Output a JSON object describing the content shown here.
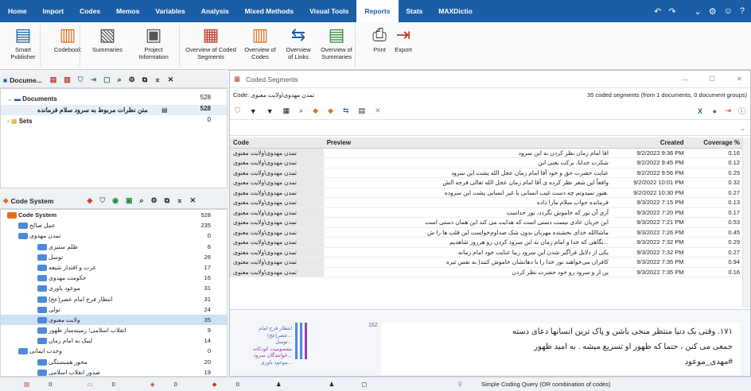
{
  "menu": [
    "Home",
    "Import",
    "Codes",
    "Memos",
    "Variables",
    "Analysis",
    "Mixed Methods",
    "Visual Tools",
    "Reports",
    "Stats",
    "MAXDictio"
  ],
  "menu_active": "Reports",
  "ribbon": [
    {
      "l1": "Smart",
      "l2": "Publisher",
      "icon": "smart-publisher-icon"
    },
    {
      "l1": "Codebook",
      "l2": "",
      "icon": "codebook-icon"
    },
    {
      "l1": "Summaries",
      "l2": "",
      "icon": "summaries-icon"
    },
    {
      "l1": "Project",
      "l2": "Information",
      "icon": "project-information-icon"
    },
    {
      "l1": "Overview of Coded",
      "l2": "Segments",
      "icon": "overview-coded-segments-icon"
    },
    {
      "l1": "Overview of",
      "l2": "Codes",
      "icon": "overview-codes-icon"
    },
    {
      "l1": "Overview",
      "l2": "of Links",
      "icon": "overview-links-icon"
    },
    {
      "l1": "Overview of",
      "l2": "Summaries",
      "icon": "overview-summaries-icon"
    },
    {
      "l1": "Print",
      "l2": "",
      "icon": "print-icon"
    },
    {
      "l1": "Export",
      "l2": "",
      "icon": "export-icon"
    }
  ],
  "doc_panel": {
    "title": "Docume...",
    "rows": [
      {
        "label": "Documents",
        "count": "528"
      },
      {
        "label": "متن نظرات مربوط به سرود سلام فرمانده",
        "count": "528"
      },
      {
        "label": "Sets",
        "count": "0"
      }
    ]
  },
  "code_panel": {
    "title": "Code System",
    "rows": [
      {
        "label": "Code System",
        "count": "528"
      },
      {
        "label": "عمل صالح",
        "count": "235"
      },
      {
        "label": "تمدن مهدوی",
        "count": "0"
      },
      {
        "label": "ظلم ستیزی",
        "count": "6"
      },
      {
        "label": "توسل",
        "count": "26"
      },
      {
        "label": "عزت و اقتدار شیعه",
        "count": "17"
      },
      {
        "label": "حکومت مهدوی",
        "count": "16"
      },
      {
        "label": "موعود باوری",
        "count": "31"
      },
      {
        "label": "انتظار فرج امام عصر(عج)",
        "count": "31"
      },
      {
        "label": "تولی",
        "count": "24"
      },
      {
        "label": "ولایت معنوی",
        "count": "35"
      },
      {
        "label": "انقلاب اسلامی؛ زمینه‌ساز ظهور",
        "count": "9"
      },
      {
        "label": "لبیک به امام زمان",
        "count": "14"
      },
      {
        "label": "وحدت ایمانی",
        "count": "0"
      },
      {
        "label": "محور همبستگی",
        "count": "20"
      },
      {
        "label": "صدور انقلاب اسلامی",
        "count": "19"
      }
    ]
  },
  "coded_segments": {
    "title": "Coded Segments",
    "code_label": "Code: تمدن مهدوی\\ولایت معنوی",
    "summary": "35 coded segments (from 1 documents, 0 document groups)",
    "headers": {
      "code": "Code",
      "preview": "Preview",
      "created": "Created",
      "coverage": "Coverage %"
    },
    "rows": [
      {
        "code": "تمدن مهدوی\\ولایت معنوی",
        "preview": "اقا امام زمان نظر کردن به این سرود",
        "created": "9/2/2022 9:36 PM",
        "coverage": "0.16"
      },
      {
        "code": "تمدن مهدوی\\ولایت معنوی",
        "preview": "شکرت خدایا، برکت یعنی این",
        "created": "9/2/2022 9:45 PM",
        "coverage": "0.12"
      },
      {
        "code": "تمدن مهدوی\\ولایت معنوی",
        "preview": "عنایت حضرت حق و خود آقا امام زمان عجل الله پشت این سرود",
        "created": "9/2/2022 9:56 PM",
        "coverage": "0.25"
      },
      {
        "code": "تمدن مهدوی\\ولایت معنوی",
        "preview": "واقعاً این شعر نظر کرده ی آقا امام زمان عجل الله تعالی فرجه الش",
        "created": "9/2/2022 10:01 PM",
        "coverage": "0.32"
      },
      {
        "code": "تمدن مهدوی\\ولایت معنوی",
        "preview": ".هنوز نمیدونم چه دست غیب انسانی یا غیر انسانی پشت این سروده",
        "created": "9/2/2022 10:30 PM",
        "coverage": "0.27"
      },
      {
        "code": "تمدن مهدوی\\ولایت معنوی",
        "preview": "فرمانده جواب سلام مارا داده",
        "created": "9/3/2022 7:15 PM",
        "coverage": "0.13"
      },
      {
        "code": "تمدن مهدوی\\ولایت معنوی",
        "preview": "آری آن نور که خاموش نگردد، نور خداست",
        "created": "9/3/2022 7:20 PM",
        "coverage": "0.17"
      },
      {
        "code": "تمدن مهدوی\\ولایت معنوی",
        "preview": "این جریان عادی نیست دستی است که هدایت می کند این همان دستی است",
        "created": "9/3/2022 7:21 PM",
        "coverage": "0.53"
      },
      {
        "code": "تمدن مهدوی\\ولایت معنوی",
        "preview": "ماشاالله خدای بخشنده مهربان بدون شک صداوم‌خواست این قلب ها را ش",
        "created": "9/3/2022 7:26 PM",
        "coverage": "0.45"
      },
      {
        "code": "تمدن مهدوی\\ولایت معنوی",
        "preview": "...نگاهی که خدا و امام زمان به این سرود کردن رو هرروز شاهدیم",
        "created": "9/3/2022 7:32 PM",
        "coverage": "0.29"
      },
      {
        "code": "تمدن مهدوی\\ولایت معنوی",
        "preview": "یکی از دلایل فراگیر شدن این سرود زیبا عنایت خود امام زمانه",
        "created": "9/3/2022 7:32 PM",
        "coverage": "0.27"
      },
      {
        "code": "تمدن مهدوی\\ولایت معنوی",
        "preview": "کافران می‌خواهند نور خدا را با دهانشان خاموش کنند( به نفس تیره",
        "created": "9/3/2022 7:35 PM",
        "coverage": "0.94"
      },
      {
        "code": "تمدن مهدوی\\ولایت معنوی",
        "preview": "پن از و سرود رو خود حضرت نظر کردن",
        "created": "9/3/2022 7:35 PM",
        "coverage": "0.16"
      }
    ]
  },
  "browser": {
    "line_number": "162",
    "codes": [
      "انتظار فرج امام عصر(عج)...",
      "توسل...",
      "مقصومیت کودکانه خوانندگان سرود...",
      "موعود باوری..."
    ],
    "text_line1": "۱۷۱. وقتی یک دنیا منتظر منجی باشن و پاک ترین انسانها دعای دسته",
    "text_line2": "جمعی می کنن ، حتما که ظهور او تسریع میشه . به امید ظهور",
    "text_line3": "#مهدی_موعود"
  },
  "status": {
    "items": [
      "0",
      "0",
      "0",
      "0"
    ],
    "query": "Simple Coding Query (OR combination of codes)"
  },
  "colors": {
    "menu": "#1a5ea8",
    "tag": "#4f8ad8",
    "selected": "#cfe0f5"
  }
}
